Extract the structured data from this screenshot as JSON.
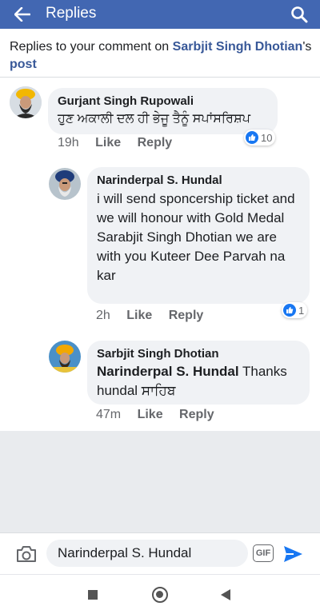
{
  "topbar": {
    "title": "Replies"
  },
  "header": {
    "prefix": "Replies to your comment on ",
    "author_link": "Sarbjit Singh Dhotian",
    "suffix": "'s",
    "post_link": "post"
  },
  "comments": [
    {
      "author": "Gurjant Singh Rupowali",
      "text": "ਹੁਣ ਅਕਾਲੀ ਦਲ ਹੀ ਭੇਜੂ ਤੈਨੂੰ ਸਪਾਂਸਰਿਸ਼ਪ",
      "time": "19h",
      "like_label": "Like",
      "reply_label": "Reply",
      "reactions": "10"
    },
    {
      "author": "Narinderpal S. Hundal",
      "text": "i will send sponcership ticket and we will honour with Gold Medal Sarabjit Singh Dhotian we are with you Kuteer Dee Parvah na kar",
      "time": "2h",
      "like_label": "Like",
      "reply_label": "Reply",
      "reactions": "1"
    },
    {
      "author": "Sarbjit Singh Dhotian",
      "mention": "Narinderpal S. Hundal",
      "text": " Thanks hundal ਸਾਹਿਬ",
      "time": "47m",
      "like_label": "Like",
      "reply_label": "Reply"
    }
  ],
  "composer": {
    "value": "Narinderpal S. Hundal",
    "gif_label": "GIF"
  },
  "colors": {
    "brand": "#4267b2",
    "link": "#385898",
    "like_blue": "#1877f2",
    "bubble": "#f0f2f5"
  },
  "icons": [
    "back-arrow-icon",
    "search-icon",
    "camera-icon",
    "gif-icon",
    "send-icon",
    "like-icon",
    "nav-recents-icon",
    "nav-home-icon",
    "nav-back-icon"
  ]
}
